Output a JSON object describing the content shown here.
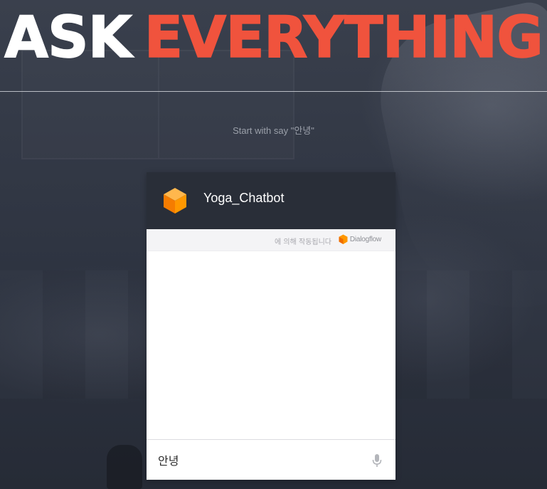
{
  "hero": {
    "title_part1": "ASK",
    "title_part2": "EVERYTHING",
    "accent_color": "#f0533d",
    "subtitle": "Start with say \"안녕\""
  },
  "chatbot": {
    "agent_name": "Yoga_Chatbot",
    "agent_icon": "dialogflow-cube-icon",
    "powered_by_text": "에 의해 작동됩니다",
    "powered_by_brand": "Dialogflow",
    "input_value": "안녕",
    "mic_icon": "microphone-icon",
    "brand_color": "#ff9800",
    "header_color": "#292e38"
  }
}
